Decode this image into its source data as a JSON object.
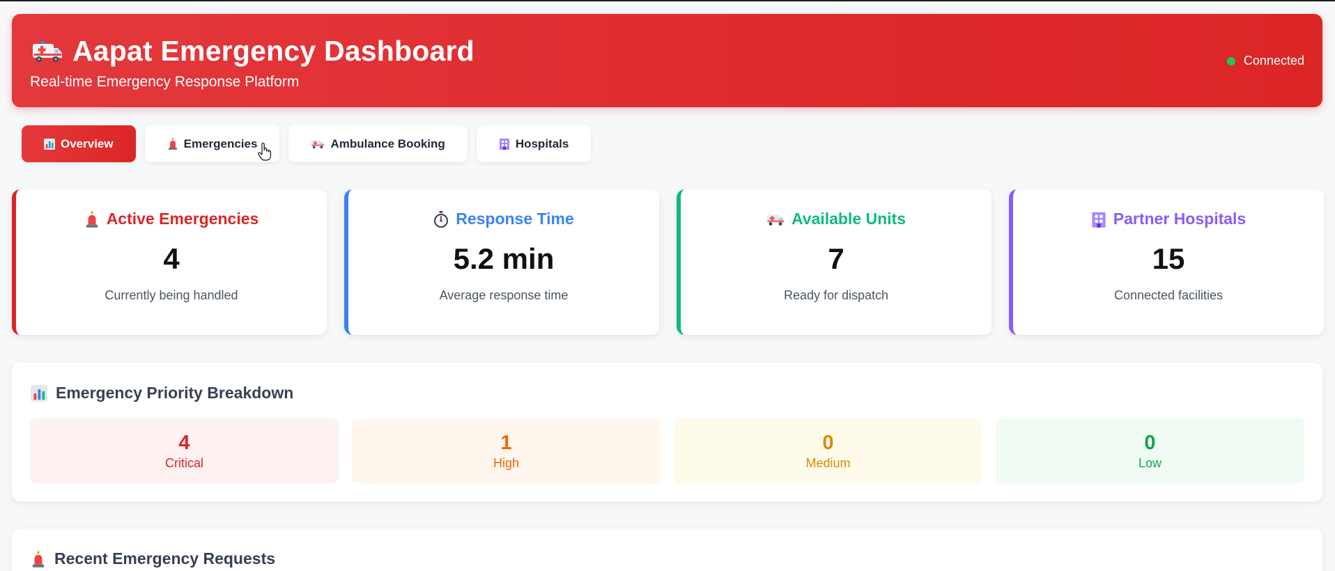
{
  "header": {
    "icon": "ambulance-icon",
    "title": "Aapat Emergency Dashboard",
    "subtitle": "Real-time Emergency Response Platform",
    "status": "Connected",
    "status_color": "#22c55e",
    "accent": "#dc2626"
  },
  "tabs": [
    {
      "icon": "chart-icon",
      "label": "Overview",
      "active": true
    },
    {
      "icon": "siren-icon",
      "label": "Emergencies"
    },
    {
      "icon": "ambulance-icon",
      "label": "Ambulance Booking"
    },
    {
      "icon": "hospital-icon",
      "label": "Hospitals"
    }
  ],
  "stats": [
    {
      "icon": "siren-icon",
      "title": "Active Emergencies",
      "value": "4",
      "desc": "Currently being handled",
      "color": "#dc2626"
    },
    {
      "icon": "stopwatch-icon",
      "title": "Response Time",
      "value": "5.2 min",
      "desc": "Average response time",
      "color": "#3b82f6"
    },
    {
      "icon": "ambulance-icon",
      "title": "Available Units",
      "value": "7",
      "desc": "Ready for dispatch",
      "color": "#10b981"
    },
    {
      "icon": "hospital-icon",
      "title": "Partner Hospitals",
      "value": "15",
      "desc": "Connected facilities",
      "color": "#8b5cf6"
    }
  ],
  "priority": {
    "icon": "chart-icon",
    "title": "Emergency Priority Breakdown",
    "items": [
      {
        "value": "4",
        "label": "Critical",
        "color": "#dc2626",
        "bg": "#fef1f1"
      },
      {
        "value": "1",
        "label": "High",
        "color": "#ea6a0c",
        "bg": "#fff6ee"
      },
      {
        "value": "0",
        "label": "Medium",
        "color": "#d98a06",
        "bg": "#fffbeb"
      },
      {
        "value": "0",
        "label": "Low",
        "color": "#16a34a",
        "bg": "#effbf3"
      }
    ]
  },
  "recent": {
    "icon": "siren-icon",
    "title": "Recent Emergency Requests"
  }
}
